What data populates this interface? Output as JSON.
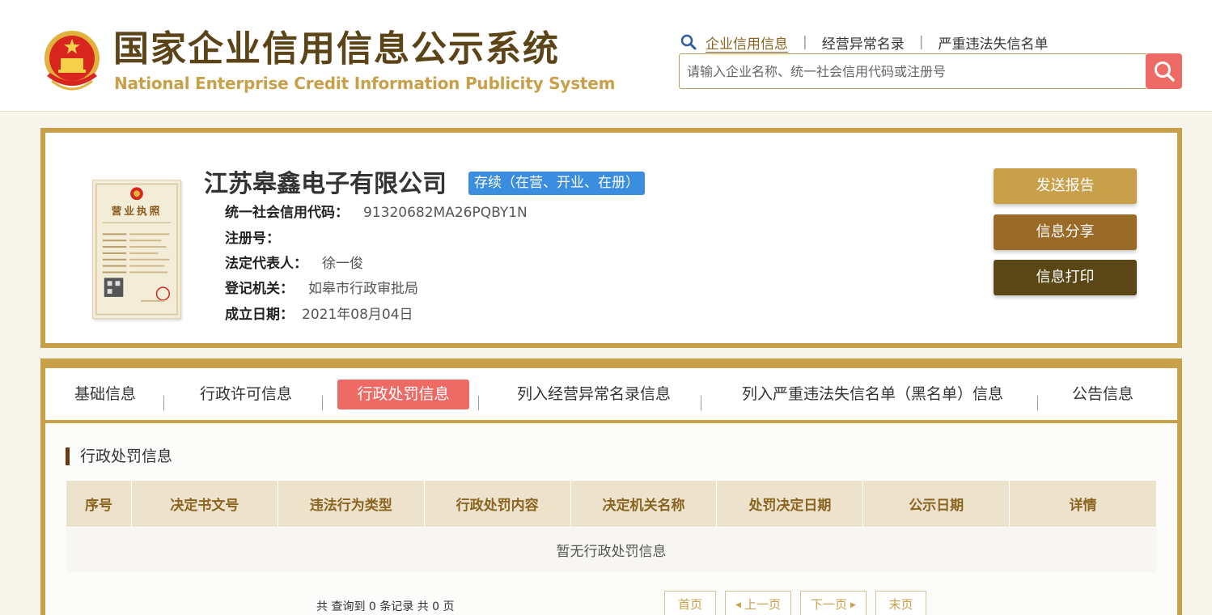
{
  "header": {
    "title_cn": "国家企业信用信息公示系统",
    "title_en": "National Enterprise Credit Information Publicity System",
    "nav": [
      {
        "label": "企业信用信息",
        "active": true
      },
      {
        "label": "经营异常名录",
        "active": false
      },
      {
        "label": "严重违法失信名单",
        "active": false
      }
    ],
    "nav_separator": "|",
    "search_placeholder": "请输入企业名称、统一社会信用代码或注册号"
  },
  "company": {
    "name": "江苏皋鑫电子有限公司",
    "status": "存续（在营、开业、在册）",
    "fields": [
      {
        "label": "统一社会信用代码：",
        "value": "91320682MA26PQBY1N"
      },
      {
        "label": "注册号：",
        "value": ""
      },
      {
        "label": "法定代表人：",
        "value": "徐一俊"
      },
      {
        "label": "登记机关：",
        "value": "如皋市行政审批局"
      },
      {
        "label": "成立日期：",
        "value": "2021年08月04日"
      }
    ],
    "license_title": "营业执照",
    "actions": {
      "send_report": "发送报告",
      "share": "信息分享",
      "print": "信息打印"
    }
  },
  "tabs": [
    {
      "label": "基础信息",
      "active": false
    },
    {
      "label": "行政许可信息",
      "active": false
    },
    {
      "label": "行政处罚信息",
      "active": true
    },
    {
      "label": "列入经营异常名录信息",
      "active": false
    },
    {
      "label": "列入严重违法失信名单（黑名单）信息",
      "active": false
    },
    {
      "label": "公告信息",
      "active": false
    }
  ],
  "penalty_section": {
    "title": "行政处罚信息",
    "columns": [
      "序号",
      "决定书文号",
      "违法行为类型",
      "行政处罚内容",
      "决定机关名称",
      "处罚决定日期",
      "公示日期",
      "详情"
    ],
    "empty_message": "暂无行政处罚信息"
  },
  "pagination": {
    "summary": "共 查询到 0 条记录 共 0 页",
    "first": "首页",
    "prev": "上一页",
    "next": "下一页",
    "last": "末页"
  },
  "colors": {
    "brand_gold": "#c9a04a",
    "brand_brown": "#5b4417",
    "active_red": "#ee6a65",
    "status_blue": "#3b8de0",
    "share_brown": "#9b6a26",
    "print_brown": "#5b4616"
  },
  "icons": {
    "emblem": "national-emblem-icon",
    "nav_search": "magnifier-icon",
    "search_button": "search-icon",
    "prev": "triangle-left-icon",
    "next": "triangle-right-icon"
  }
}
